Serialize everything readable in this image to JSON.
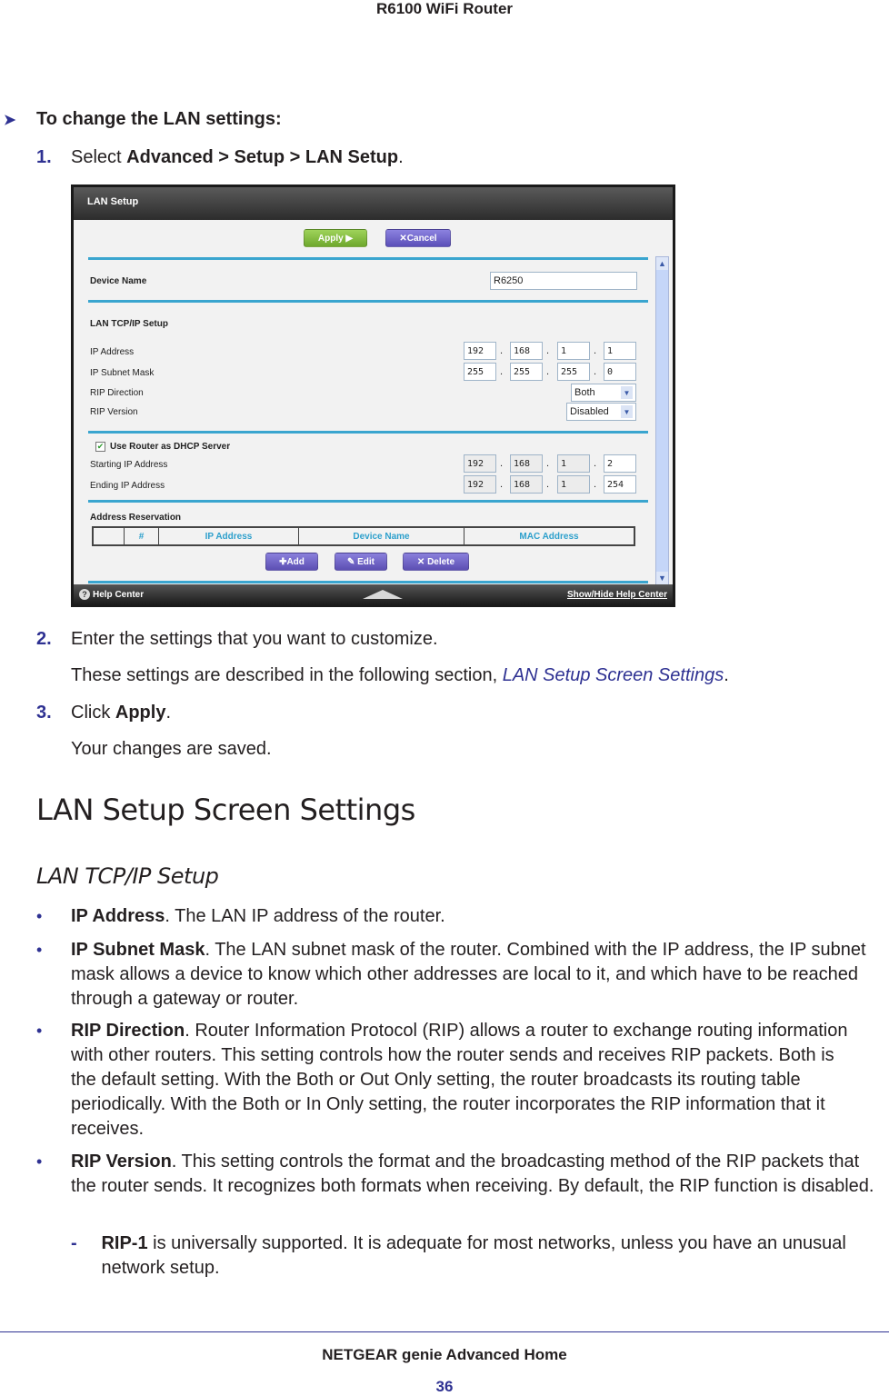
{
  "header": {
    "title": "R6100 WiFi Router"
  },
  "procedure": {
    "title": "To change the LAN settings:",
    "steps": [
      {
        "num": "1.",
        "prefix": "Select ",
        "bold": "Advanced > Setup > LAN Setup",
        "suffix": "."
      },
      {
        "num": "2.",
        "text": "Enter the settings that you want to customize."
      },
      {
        "num": "3.",
        "prefix": "Click ",
        "bold": "Apply",
        "suffix": "."
      }
    ],
    "step2_note_prefix": "These settings are described in the following section, ",
    "step2_note_link": "LAN Setup Screen Settings",
    "step2_note_suffix": ".",
    "step3_note": "Your changes are saved."
  },
  "screenshot": {
    "title": "LAN Setup",
    "apply_label": "Apply ▶",
    "cancel_label": "✕Cancel",
    "device_name_label": "Device Name",
    "device_name_value": "R6250",
    "tcpip_heading": "LAN TCP/IP Setup",
    "ip_address_label": "IP Address",
    "ip_address": [
      "192",
      "168",
      "1",
      "1"
    ],
    "subnet_label": "IP Subnet Mask",
    "subnet": [
      "255",
      "255",
      "255",
      "0"
    ],
    "rip_direction_label": "RIP Direction",
    "rip_direction_value": "Both",
    "rip_version_label": "RIP Version",
    "rip_version_value": "Disabled",
    "dhcp_label": "Use Router as DHCP Server",
    "dhcp_checked": true,
    "start_ip_label": "Starting IP Address",
    "start_ip": [
      "192",
      "168",
      "1",
      "2"
    ],
    "end_ip_label": "Ending IP Address",
    "end_ip": [
      "192",
      "168",
      "1",
      "254"
    ],
    "reservation_heading": "Address Reservation",
    "table_columns": [
      "",
      "#",
      "IP Address",
      "Device Name",
      "MAC Address"
    ],
    "add_label": "✚Add",
    "edit_label": "✎ Edit",
    "delete_label": "✕ Delete",
    "help_center": "Help Center",
    "show_hide_help": "Show/Hide Help Center",
    "colors": {
      "apply": "#7cb83a",
      "cancel": "#6a5fc4",
      "divider": "#3aa5cf",
      "column_header": "#2ea0cc"
    }
  },
  "section": {
    "heading": "LAN Setup Screen Settings",
    "subheading": "LAN TCP/IP Setup",
    "bullets": [
      {
        "term": "IP Address",
        "text": ". The LAN IP address of the router."
      },
      {
        "term": "IP Subnet Mask",
        "text": ". The LAN subnet mask of the router. Combined with the IP address, the IP subnet mask allows a device to know which other addresses are local to it, and which have to be reached through a gateway or router."
      },
      {
        "term": "RIP Direction",
        "text": ". Router Information Protocol (RIP) allows a router to exchange routing information with other routers. This setting controls how the router sends and receives RIP packets. Both is the default setting. With the Both or Out Only setting, the router broadcasts its routing table periodically. With the Both or In Only setting, the router incorporates the RIP information that it receives."
      },
      {
        "term": "RIP Version",
        "text": ". This setting controls the format and the broadcasting method of the RIP packets that the router sends. It recognizes both formats when receiving. By default, the RIP function is disabled."
      }
    ],
    "sub_bullets": [
      {
        "term": "RIP-1",
        "text": " is universally supported. It is adequate for most networks, unless you have an unusual network setup."
      }
    ],
    "bullet_mark": "•",
    "dash_mark": "-"
  },
  "footer": {
    "title": "NETGEAR genie Advanced Home",
    "page": "36"
  },
  "colors": {
    "accent": "#2e3192",
    "text": "#231f20"
  }
}
